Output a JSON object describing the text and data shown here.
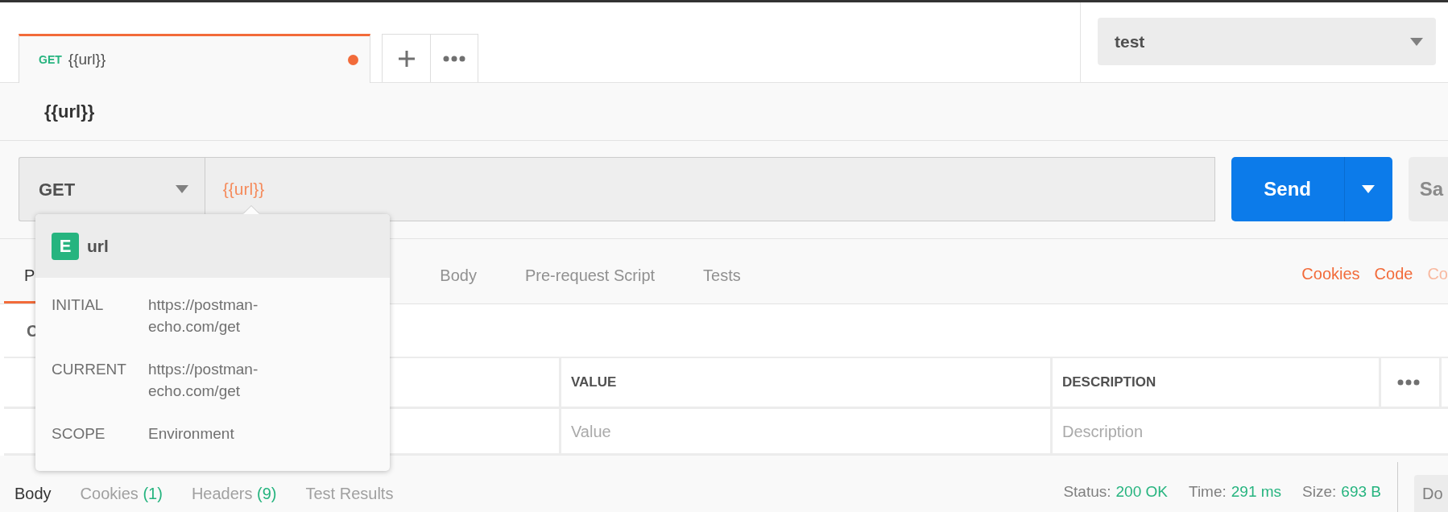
{
  "tabs": [
    {
      "method": "GET",
      "label": "{{url}}",
      "selected": true,
      "unsaved": true
    }
  ],
  "environment": {
    "value": "test"
  },
  "request_title": "{{url}}",
  "method": {
    "value": "GET"
  },
  "url": {
    "value": "{{url}}"
  },
  "send_button": "Send",
  "save_button": "Sa",
  "request_tabs": [
    {
      "label": "P",
      "selected": true
    },
    {
      "label": "Body",
      "selected": false
    },
    {
      "label": "Pre-request Script",
      "selected": false
    },
    {
      "label": "Tests",
      "selected": false
    }
  ],
  "request_links": [
    {
      "label": "Cookies",
      "dimmed": false
    },
    {
      "label": "Code",
      "dimmed": false
    },
    {
      "label": "Co",
      "dimmed": true
    }
  ],
  "section_label": "C",
  "params_table": {
    "columns": [
      "VALUE",
      "DESCRIPTION"
    ],
    "rows": [
      {
        "value_placeholder": "Value",
        "description_placeholder": "Description"
      }
    ]
  },
  "variable_popover": {
    "scope_badge": "E",
    "name": "url",
    "fields": [
      {
        "label": "INITIAL",
        "value": "https://postman-echo.com/get"
      },
      {
        "label": "CURRENT",
        "value": "https://postman-echo.com/get"
      },
      {
        "label": "SCOPE",
        "value": "Environment"
      }
    ]
  },
  "response_tabs": [
    {
      "label": "Body",
      "selected": true
    },
    {
      "label": "Cookies",
      "count": "(1)",
      "selected": false
    },
    {
      "label": "Headers",
      "count": "(9)",
      "selected": false
    },
    {
      "label": "Test Results",
      "selected": false
    }
  ],
  "response_meta": [
    {
      "label": "Status:",
      "value": "200 OK"
    },
    {
      "label": "Time:",
      "value": "291 ms"
    },
    {
      "label": "Size:",
      "value": "693 B"
    }
  ],
  "download_button": "Do"
}
